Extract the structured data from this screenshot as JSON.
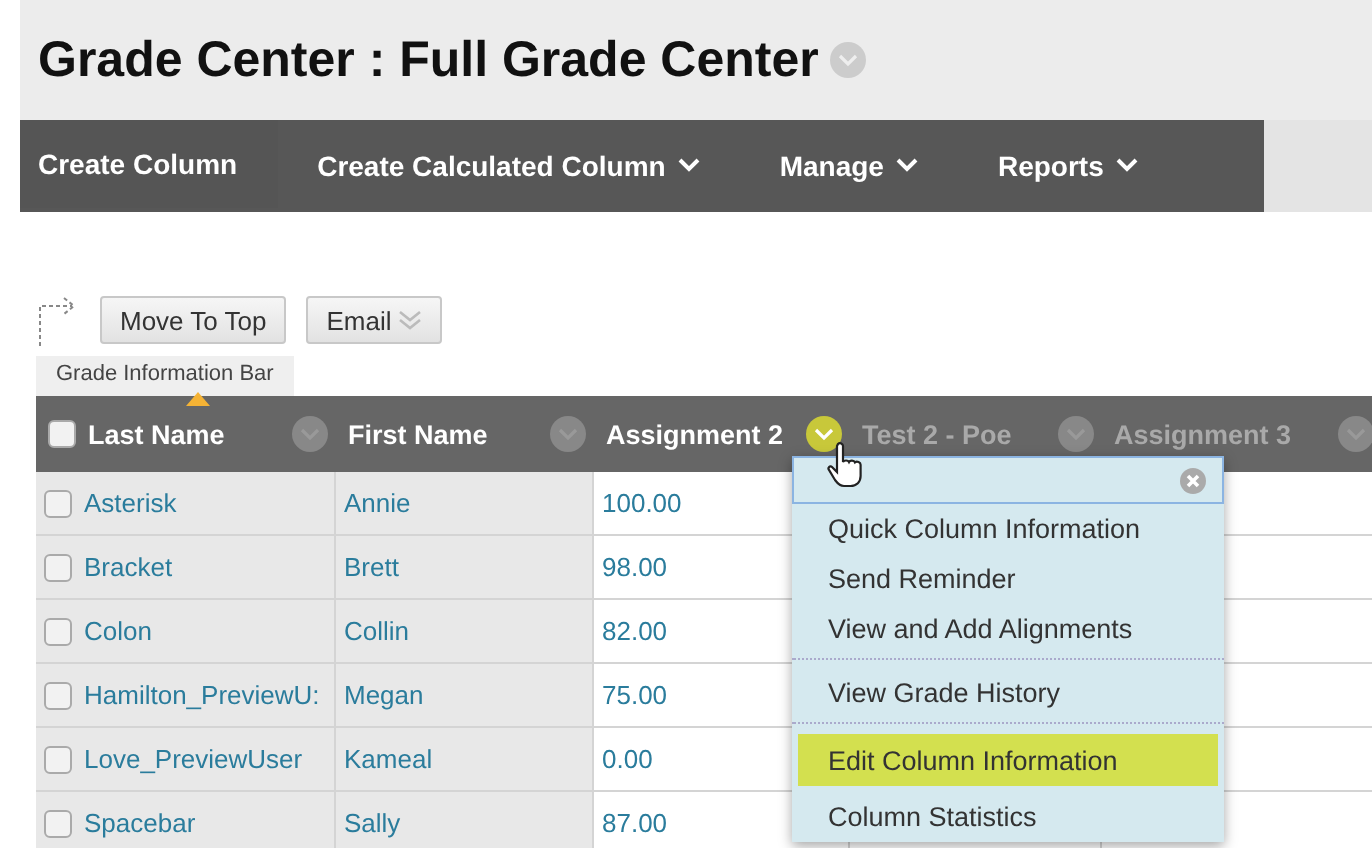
{
  "page_title": "Grade Center : Full Grade Center",
  "nav": [
    {
      "label": "Create Column",
      "has_menu": false
    },
    {
      "label": "Create Calculated Column",
      "has_menu": true
    },
    {
      "label": "Manage",
      "has_menu": true
    },
    {
      "label": "Reports",
      "has_menu": true
    }
  ],
  "toolbar": [
    {
      "label": "Move To Top",
      "kind": "plain"
    },
    {
      "label": "Email",
      "kind": "menu"
    }
  ],
  "info_bar_tab": "Grade Information Bar",
  "select_all": {
    "checked": false
  },
  "columns": [
    {
      "label": "Last Name",
      "sorted": true,
      "dimmed": false,
      "menu_open": false
    },
    {
      "label": "First Name",
      "sorted": false,
      "dimmed": false,
      "menu_open": false
    },
    {
      "label": "Assignment 2",
      "sorted": false,
      "dimmed": false,
      "menu_open": true
    },
    {
      "label": "Test 2 - Poe",
      "sorted": false,
      "dimmed": true,
      "menu_open": false
    },
    {
      "label": "Assignment 3",
      "sorted": false,
      "dimmed": true,
      "menu_open": false
    }
  ],
  "rows": [
    {
      "checked": false,
      "cells": [
        "Asterisk",
        "Annie",
        "100.00"
      ]
    },
    {
      "checked": false,
      "cells": [
        "Bracket",
        "Brett",
        "98.00"
      ]
    },
    {
      "checked": false,
      "cells": [
        "Colon",
        "Collin",
        "82.00"
      ]
    },
    {
      "checked": false,
      "cells": [
        "Hamilton_PreviewU:",
        "Megan",
        "75.00"
      ]
    },
    {
      "checked": false,
      "cells": [
        "Love_PreviewUser",
        "Kameal",
        "0.00"
      ]
    },
    {
      "checked": false,
      "cells": [
        "Spacebar",
        "Sally",
        "87.00"
      ]
    }
  ],
  "column_menu": [
    {
      "label": "Quick Column Information",
      "selected": false,
      "divider_after": false
    },
    {
      "label": "Send Reminder",
      "selected": false,
      "divider_after": false
    },
    {
      "label": "View and Add Alignments",
      "selected": false,
      "divider_after": true
    },
    {
      "label": "View Grade History",
      "selected": false,
      "divider_after": true
    },
    {
      "label": "Edit Column Information",
      "selected": true,
      "divider_after": false
    },
    {
      "label": "Column Statistics",
      "selected": false,
      "divider_after": false
    }
  ]
}
